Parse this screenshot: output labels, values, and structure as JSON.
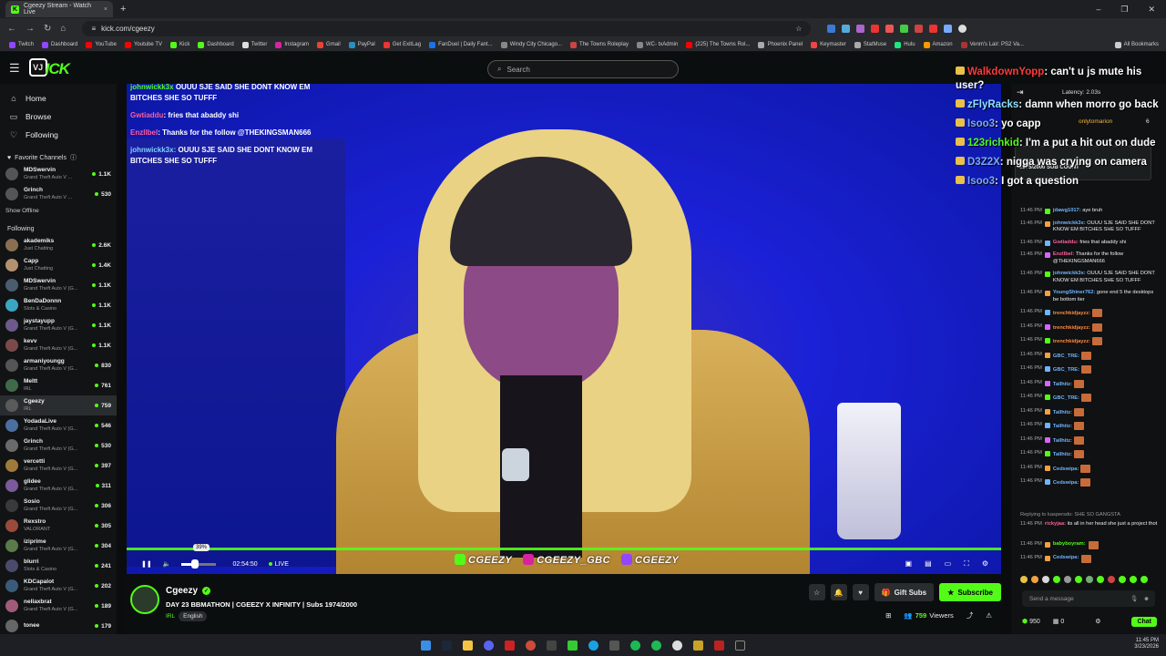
{
  "browser": {
    "tab_title": "Cgeezy Stream - Watch Live",
    "tab_close": "×",
    "new_tab": "+",
    "url": "kick.com/cgeezy",
    "window_controls": [
      "–",
      "❐",
      "✕"
    ],
    "bookmarks": [
      "Twitch",
      "Dashboard",
      "YouTube",
      "Youtube TV",
      "Kick",
      "Dashboard",
      "Twitter",
      "Instagram",
      "Gmail",
      "PayPal",
      "Get ExitLag",
      "FanDuel | Daily Fant...",
      "Windy City Chicago...",
      "The Towns Roleplay",
      "WC- txAdmin",
      "(225) The Towns Rol...",
      "Phoenix Panel",
      "Keymaster",
      "StatMuse",
      "Hulu",
      "Amazon",
      "Venm's Lair: PS2 Va..."
    ],
    "all_bookmarks": "All Bookmarks"
  },
  "nav": {
    "search_placeholder": "Search",
    "home": "Home",
    "browse": "Browse",
    "following": "Following",
    "favorite_channels": "Favorite Channels",
    "show_offline": "Show Offline",
    "following_header": "Following"
  },
  "favorites": [
    {
      "name": "MDSwervin",
      "game": "Grand Theft Auto V ...",
      "viewers": "1.1K"
    },
    {
      "name": "Grinch",
      "game": "Grand Theft Auto V ...",
      "viewers": "530"
    }
  ],
  "following_list": [
    {
      "name": "akademiks",
      "game": "Just Chatting",
      "viewers": "2.6K",
      "color": "#8a6e52"
    },
    {
      "name": "Capp",
      "game": "Just Chatting",
      "viewers": "1.4K",
      "color": "#b39270"
    },
    {
      "name": "MDSwervin",
      "game": "Grand Theft Auto V (G...",
      "viewers": "1.1K",
      "color": "#4a5d6e"
    },
    {
      "name": "BenDaDonnn",
      "game": "Slots & Casino",
      "viewers": "1.1K",
      "color": "#3aa6c2"
    },
    {
      "name": "jaystayupp",
      "game": "Grand Theft Auto V (G...",
      "viewers": "1.1K",
      "color": "#6b5a8a"
    },
    {
      "name": "kevv",
      "game": "Grand Theft Auto V (G...",
      "viewers": "1.1K",
      "color": "#7a4a4a"
    },
    {
      "name": "armaniyoungg",
      "game": "Grand Theft Auto V (G...",
      "viewers": "830",
      "color": "#555"
    },
    {
      "name": "Meltt",
      "game": "IRL",
      "viewers": "761",
      "color": "#3f6a4a"
    },
    {
      "name": "Cgeezy",
      "game": "IRL",
      "viewers": "759",
      "color": "#5a5a5a"
    },
    {
      "name": "YodadaLive",
      "game": "Grand Theft Auto V (G...",
      "viewers": "546",
      "color": "#4a6fa0"
    },
    {
      "name": "Grinch",
      "game": "Grand Theft Auto V (G...",
      "viewers": "530",
      "color": "#6a6a6a"
    },
    {
      "name": "vercetti",
      "game": "Grand Theft Auto V (G...",
      "viewers": "397",
      "color": "#a07a3a"
    },
    {
      "name": "glidee",
      "game": "Grand Theft Auto V (G...",
      "viewers": "311",
      "color": "#7a5a9a"
    },
    {
      "name": "Sosio",
      "game": "Grand Theft Auto V (G...",
      "viewers": "306",
      "color": "#3a3a3a"
    },
    {
      "name": "Rexstro",
      "game": "VALORANT",
      "viewers": "305",
      "color": "#9a4a3a"
    },
    {
      "name": "iziprime",
      "game": "Grand Theft Auto V (G...",
      "viewers": "304",
      "color": "#5a7a4a"
    },
    {
      "name": "blurri",
      "game": "Slots & Casino",
      "viewers": "241",
      "color": "#4a4a6a"
    },
    {
      "name": "KDCapalot",
      "game": "Grand Theft Auto V (G...",
      "viewers": "202",
      "color": "#3a5a7a"
    },
    {
      "name": "nellaxbrat",
      "game": "Grand Theft Auto V (G...",
      "viewers": "189",
      "color": "#a05a7a"
    },
    {
      "name": "tonee",
      "game": "",
      "viewers": "179",
      "color": "#666"
    }
  ],
  "video_overlay_chat": [
    {
      "user": "johnwickk3x",
      "text": "OUUU SJE SAID SHE DONT KNOW EM BITCHES SHE SO TUFFF",
      "partial": true
    },
    {
      "user": "Gwtiaddu",
      "text": "fries that abaddy shi"
    },
    {
      "user": "Enzllbel",
      "text": "Thanks for the follow @THEKINGSMAN666"
    },
    {
      "user": "johnwickk3x:",
      "text": "OUUU SJE SAID SHE DONT KNOW EM BITCHES SHE SO TUFFF"
    }
  ],
  "banner": [
    "CGEEZY",
    "CGEEZY_GBC",
    "CGEEZY"
  ],
  "player": {
    "volume_tooltip": "39%",
    "volume_level": 0.39,
    "time": "02:54:50",
    "live": "LIVE"
  },
  "stream": {
    "channel": "Cgeezy",
    "title": "DAY 23 BBMATHON | CGEEZY X INFINITY | Subs 1974/2000",
    "category": "IRL",
    "language": "English",
    "gift_subs": "Gift Subs",
    "subscribe": "Subscribe",
    "viewers": "759",
    "viewers_label": "Viewers"
  },
  "right_overlay_chat": [
    {
      "user": "WalkdownYopp",
      "text": ": can't u js mute his user?",
      "color": "#ff3b3b"
    },
    {
      "user": "zFlyRacks",
      "text": ": damn when morro go back",
      "color": "#8ee0ff"
    },
    {
      "user": "Isoo3",
      "text": ": yo capp",
      "color": "#7aa7ff"
    },
    {
      "user": "123richkid",
      "text": ": I'm a put a hit out on dude",
      "color": "#53fc18"
    },
    {
      "user": "D3Z2X",
      "text": ": nigga was crying on camera",
      "color": "#7aa7ff"
    },
    {
      "user": "Isoo3",
      "text": ": I got a question",
      "color": "#7aa7ff"
    }
  ],
  "chat_panel": {
    "latency": "Latency: 2.03s",
    "top_user": "onlytomarion",
    "top_count": "6",
    "sub_goal": "1975/2000 SUB COUNT"
  },
  "chat_messages": [
    {
      "time": "11:46 PM",
      "user": "jdawg1017:",
      "text": "aye bruh",
      "color": "#6fb4ff"
    },
    {
      "time": "11:46 PM",
      "user": "johnwickk3x:",
      "text": "OUUU SJE SAID SHE DONT KNOW EM BITCHES SHE SO TUFFF",
      "color": "#6fb4ff"
    },
    {
      "time": "11:46 PM",
      "user": "Gwtiaddu:",
      "text": "fries that abaddy shi",
      "color": "#ff5e9a"
    },
    {
      "time": "11:46 PM",
      "user": "Enzllbel:",
      "text": "Thanks for the follow @THEKINGSMAN666",
      "color": "#ff5e9a"
    },
    {
      "time": "11:46 PM",
      "user": "johnwickk3x:",
      "text": "OUUU SJE SAID SHE DONT KNOW EM BITCHES SHE SO TUFFF",
      "color": "#6fb4ff"
    },
    {
      "time": "11:46 PM",
      "user": "YoungShiner762:",
      "text": "gone end 5 the desktops be bottom tier",
      "color": "#6fb4ff"
    },
    {
      "time": "11:46 PM",
      "user": "trenchkidjayzz:",
      "text": "",
      "color": "#ff8a3a",
      "emote": true
    },
    {
      "time": "11:46 PM",
      "user": "trenchkidjayzz:",
      "text": "",
      "color": "#ff8a3a",
      "emote": true
    },
    {
      "time": "11:46 PM",
      "user": "trenchkidjayzz:",
      "text": "",
      "color": "#ff8a3a",
      "emote": true
    },
    {
      "time": "11:46 PM",
      "user": "GBC_TRE:",
      "text": "",
      "color": "#6fb4ff",
      "emote": true
    },
    {
      "time": "11:46 PM",
      "user": "GBC_TRE:",
      "text": "",
      "color": "#6fb4ff",
      "emote": true
    },
    {
      "time": "11:46 PM",
      "user": "Tallhitz:",
      "text": "",
      "color": "#6fb4ff",
      "emote": true
    },
    {
      "time": "11:46 PM",
      "user": "GBC_TRE:",
      "text": "",
      "color": "#6fb4ff",
      "emote": true
    },
    {
      "time": "11:46 PM",
      "user": "Tallhitz:",
      "text": "",
      "color": "#6fb4ff",
      "emote": true
    },
    {
      "time": "11:46 PM",
      "user": "Tallhitz:",
      "text": "",
      "color": "#6fb4ff",
      "emote": true
    },
    {
      "time": "11:46 PM",
      "user": "Tallhitz:",
      "text": "",
      "color": "#6fb4ff",
      "emote": true
    },
    {
      "time": "11:46 PM",
      "user": "Tallhitz:",
      "text": "",
      "color": "#6fb4ff",
      "emote": true
    },
    {
      "time": "11:46 PM",
      "user": "Cedswipa:",
      "text": "",
      "color": "#6fb4ff",
      "emote": true
    },
    {
      "time": "11:46 PM",
      "user": "Cedswipa:",
      "text": "",
      "color": "#6fb4ff",
      "emote": true
    }
  ],
  "chat_reply": {
    "replying": "Replying to kaspersdo: SHE SO GANGSTA",
    "time": "11:46 PM",
    "user": "rickyjaa:",
    "text": "its all in her head she just a project thot"
  },
  "chat_tail": [
    {
      "time": "11:46 PM",
      "user": "babyboyram:",
      "color": "#53fc18"
    },
    {
      "time": "11:46 PM",
      "user": "Cedswipa:",
      "color": "#6fb4ff"
    }
  ],
  "chat_input_placeholder": "Send a message",
  "chat_points": "950",
  "chat_count": "0",
  "chat_button": "Chat",
  "tray": {
    "time": "11:45 PM",
    "date": "3/23/2026"
  }
}
